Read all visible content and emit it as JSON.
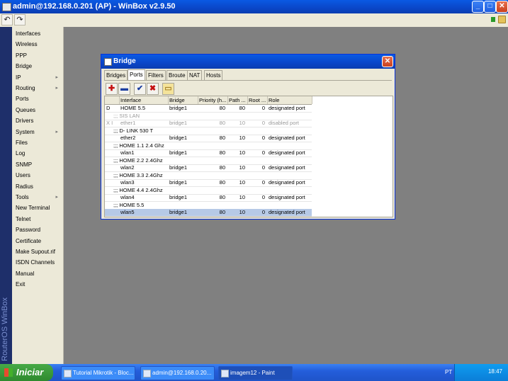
{
  "window": {
    "title": "admin@192.168.0.201 (AP) - WinBox v2.9.50"
  },
  "toolbar": {
    "undo": "↶",
    "redo": "↷"
  },
  "brand": "RouterOS WinBox",
  "menu": [
    {
      "label": "Interfaces",
      "submenu": false
    },
    {
      "label": "Wireless",
      "submenu": false
    },
    {
      "label": "PPP",
      "submenu": false
    },
    {
      "label": "Bridge",
      "submenu": false
    },
    {
      "label": "IP",
      "submenu": true
    },
    {
      "label": "Routing",
      "submenu": true
    },
    {
      "label": "Ports",
      "submenu": false
    },
    {
      "label": "Queues",
      "submenu": false
    },
    {
      "label": "Drivers",
      "submenu": false
    },
    {
      "label": "System",
      "submenu": true
    },
    {
      "label": "Files",
      "submenu": false
    },
    {
      "label": "Log",
      "submenu": false
    },
    {
      "label": "SNMP",
      "submenu": false
    },
    {
      "label": "Users",
      "submenu": false
    },
    {
      "label": "Radius",
      "submenu": false
    },
    {
      "label": "Tools",
      "submenu": true
    },
    {
      "label": "New Terminal",
      "submenu": false
    },
    {
      "label": "Telnet",
      "submenu": false
    },
    {
      "label": "Password",
      "submenu": false
    },
    {
      "label": "Certificate",
      "submenu": false
    },
    {
      "label": "Make Supout.rif",
      "submenu": false
    },
    {
      "label": "ISDN Channels",
      "submenu": false
    },
    {
      "label": "Manual",
      "submenu": false
    },
    {
      "label": "Exit",
      "submenu": false
    }
  ],
  "bridge_window": {
    "title": "Bridge",
    "tabs": [
      "Bridges",
      "Ports",
      "Filters",
      "Broute",
      "NAT",
      "Hosts"
    ],
    "active_tab": "Ports",
    "columns": [
      "",
      "Interface",
      "Bridge",
      "Priority (h...",
      "Path ...",
      "Root ...",
      "Role"
    ],
    "rows": [
      {
        "type": "row",
        "flag": "D",
        "interface": "HOME 5.5",
        "bridge": "bridge1",
        "priority": "80",
        "path": "80",
        "root": "0",
        "role": "designated port"
      },
      {
        "type": "comment",
        "text": ";;; SIS LAN",
        "muted": true
      },
      {
        "type": "row",
        "flag": "X I",
        "interface": "ether1",
        "bridge": "bridge1",
        "priority": "80",
        "path": "10",
        "root": "0",
        "role": "disabled port",
        "disabled": true
      },
      {
        "type": "comment",
        "text": ";;; D- LINK 530 T"
      },
      {
        "type": "row",
        "flag": "",
        "interface": "ether2",
        "bridge": "bridge1",
        "priority": "80",
        "path": "10",
        "root": "0",
        "role": "designated port"
      },
      {
        "type": "comment",
        "text": ";;; HOME 1.1 2.4 Ghz"
      },
      {
        "type": "row",
        "flag": "",
        "interface": "wlan1",
        "bridge": "bridge1",
        "priority": "80",
        "path": "10",
        "root": "0",
        "role": "designated port"
      },
      {
        "type": "comment",
        "text": ";;; HOME 2.2  2.4Ghz"
      },
      {
        "type": "row",
        "flag": "",
        "interface": "wlan2",
        "bridge": "bridge1",
        "priority": "80",
        "path": "10",
        "root": "0",
        "role": "designated port"
      },
      {
        "type": "comment",
        "text": ";;; HOME 3.3  2.4Ghz"
      },
      {
        "type": "row",
        "flag": "",
        "interface": "wlan3",
        "bridge": "bridge1",
        "priority": "80",
        "path": "10",
        "root": "0",
        "role": "designated port"
      },
      {
        "type": "comment",
        "text": ";;; HOME 4.4   2.4Ghz"
      },
      {
        "type": "row",
        "flag": "",
        "interface": "wlan4",
        "bridge": "bridge1",
        "priority": "80",
        "path": "10",
        "root": "0",
        "role": "designated port"
      },
      {
        "type": "comment",
        "text": ";;; HOME 5.5"
      },
      {
        "type": "row",
        "flag": "",
        "interface": "wlan5",
        "bridge": "bridge1",
        "priority": "80",
        "path": "10",
        "root": "0",
        "role": "designated port",
        "selected": true
      }
    ]
  },
  "taskbar": {
    "start_label": "Iniciar",
    "tasks": [
      {
        "label": "Tutorial Mikrotik - Bloc...",
        "active": false
      },
      {
        "label": "admin@192.168.0.20...",
        "active": false
      },
      {
        "label": "imagem12 - Paint",
        "active": true
      }
    ],
    "language": "PT",
    "clock": "18:47"
  },
  "colors": {
    "titlebar": "#0a46c8",
    "workspace": "#808080",
    "selection": "#b6c9e6",
    "taskbar": "#245edb"
  }
}
